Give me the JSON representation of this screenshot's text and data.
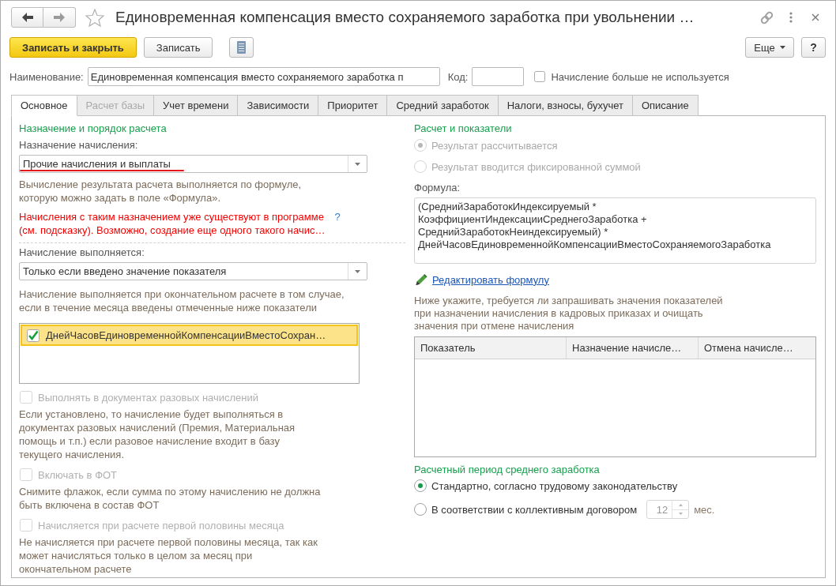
{
  "window": {
    "title": "Единовременная компенсация вместо сохраняемого заработка при увольнении …"
  },
  "nav": [
    {
      "kind": "back",
      "disabled": false
    },
    {
      "kind": "forward",
      "disabled": true
    }
  ],
  "toolbar": {
    "buttons": [
      {
        "kind": "primary",
        "label": "Записать и закрыть"
      },
      {
        "kind": "normal",
        "label": "Записать"
      },
      {
        "kind": "icon"
      }
    ],
    "more_button": "Еще",
    "help_button": "?"
  },
  "header": {
    "name_label": "Наименование:",
    "name_value": "Единовременная компенсация вместо сохраняемого заработка п",
    "code_label": "Код:",
    "not_used": {
      "label": "Начисление больше не используется",
      "checked": false
    }
  },
  "tabs": [
    {
      "label": "Основное",
      "selected": true,
      "disabled": false
    },
    {
      "label": "Расчет базы",
      "selected": false,
      "disabled": true
    },
    {
      "label": "Учет времени",
      "selected": false,
      "disabled": false
    },
    {
      "label": "Зависимости",
      "selected": false,
      "disabled": false
    },
    {
      "label": "Приоритет",
      "selected": false,
      "disabled": false
    },
    {
      "label": "Средний заработок",
      "selected": false,
      "disabled": false
    },
    {
      "label": "Налоги, взносы, бухучет",
      "selected": false,
      "disabled": false
    },
    {
      "label": "Описание",
      "selected": false,
      "disabled": false
    }
  ],
  "left": {
    "title": "Назначение и порядок расчета",
    "purpose": {
      "label": "Назначение начисления:",
      "value": "Прочие начисления и выплаты",
      "underlined": true
    },
    "purpose_hint": "Вычисление результата расчета выполняется по формуле,\nкоторую можно задать в поле «Формула».",
    "warning": {
      "text": "Начисления с таким назначением уже существуют в программе\n(см. подсказку). Возможно, создание еще одного такого начис…",
      "help": "?"
    },
    "execution": {
      "label": "Начисление выполняется:",
      "value": "Только если введено значение показателя"
    },
    "execution_hint": "Начисление выполняется при окончательном расчете в том случае,\nесли в течение месяца введены отмеченные ниже показатели",
    "indicators": [
      {
        "label": "ДнейЧасовЕдиновременнойКомпенсацииВместоСохран…",
        "checked": true,
        "selected": true
      }
    ],
    "options": [
      {
        "label": "Выполнять в документах разовых начислений",
        "checked": false,
        "disabled": true,
        "hint": "Если установлено, то начисление будет выполняться в\nдокументах разовых начислений (Премия, Материальная\nпомощь и т.п.) если разовое начисление входит в базу\nтекущего начисления."
      },
      {
        "label": "Включать в ФОТ",
        "checked": false,
        "disabled": true,
        "hint": "Снимите флажок, если сумма по этому начислению не должна\nбыть включена в состав ФОТ"
      },
      {
        "label": "Начисляется при расчете первой половины месяца",
        "checked": false,
        "disabled": true,
        "hint": "Не начисляется при расчете первой половины месяца, так как\nможет начисляться только в целом за месяц при\nокончательном расчете"
      }
    ]
  },
  "right": {
    "title": "Расчет и показатели",
    "calc_options": [
      {
        "label": "Результат рассчитывается",
        "selected": true,
        "disabled": true
      },
      {
        "label": "Результат вводится фиксированной суммой",
        "selected": false,
        "disabled": true
      }
    ],
    "formula": {
      "label": "Формула:",
      "value": "(СреднийЗаработокИндексируемый *\nКоэффициентИндексацииСреднегоЗаработка +\nСреднийЗаработокНеиндексируемый) *\nДнейЧасовЕдиновременнойКомпенсацииВместоСохраняемогоЗаработка"
    },
    "edit_link": "Редактировать формулу",
    "indicators_hint": "Ниже укажите, требуется ли запрашивать значения показателей\nпри назначении начисления в кадровых приказах и очищать\nзначения при отмене начисления",
    "indicators_table": {
      "columns": [
        "Показатель",
        "Назначение начисле…",
        "Отмена начисле…"
      ]
    },
    "period": {
      "title": "Расчетный период среднего заработка",
      "options": [
        {
          "label": "Стандартно, согласно трудовому законодательству",
          "selected": true
        },
        {
          "label": "В соответствии с коллективным договором",
          "selected": false,
          "months": {
            "value": "12",
            "unit": "мес.",
            "disabled": true
          }
        }
      ]
    }
  }
}
